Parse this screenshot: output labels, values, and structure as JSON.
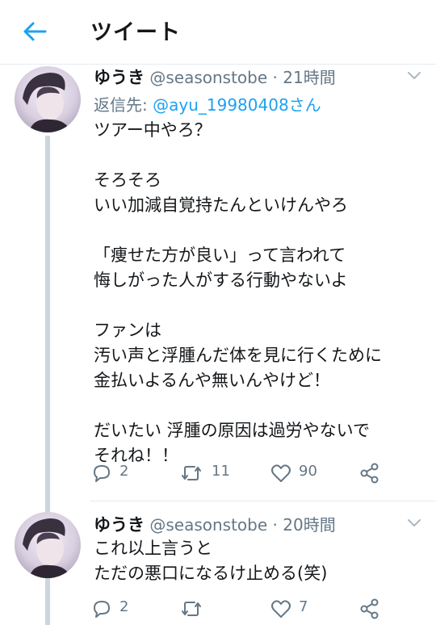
{
  "header": {
    "title": "ツイート"
  },
  "tweets": [
    {
      "name": "ゆうき",
      "handle": "@seasonstobe",
      "time": "· 21時間",
      "reply_prefix": "返信先: ",
      "reply_mention": "@ayu_19980408さん",
      "text": "ツアー中やろ？\n\nそろそろ\nいい加減自覚持たんといけんやろ\n\n「痩せた方が良い」って言われて\n悔しがった人がする行動やないよ\n\nファンは\n汚い声と浮腫んだ体を見に行くために\n金払いよるんや無いんやけど！\n\nだいたい 浮腫の原因は過労やないで\nそれね！！",
      "reply_count": "2",
      "retweet_count": "11",
      "like_count": "90"
    },
    {
      "name": "ゆうき",
      "handle": "@seasonstobe",
      "time": "· 20時間",
      "text": "これ以上言うと\nただの悪口になるけ止める(笑)",
      "reply_count": "2",
      "retweet_count": "",
      "like_count": "7"
    }
  ],
  "icons": {
    "back": "arrow-left-icon",
    "caret": "chevron-down-icon",
    "reply": "reply-icon",
    "retweet": "retweet-icon",
    "like": "heart-icon",
    "share": "share-icon"
  },
  "colors": {
    "accent": "#1da1f2",
    "secondary_text": "#657786",
    "thread_line": "#ccd6dd"
  }
}
